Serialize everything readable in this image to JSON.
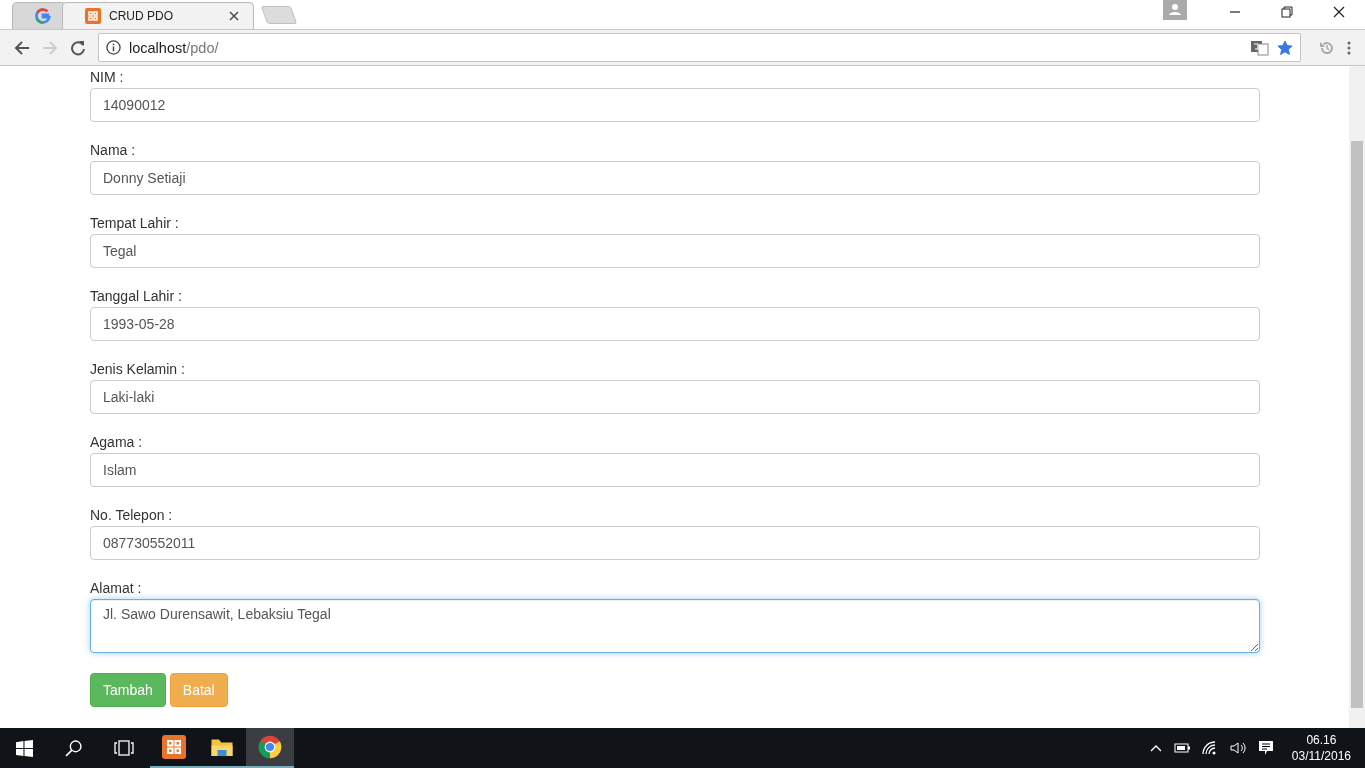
{
  "browser": {
    "tabs": [
      {
        "kind": "google",
        "selected": false
      },
      {
        "kind": "xampp",
        "title": "CRUD PDO",
        "selected": true
      }
    ],
    "url_host": "localhost",
    "url_path": "/pdo/",
    "bookmarked": true
  },
  "form": {
    "fields": [
      {
        "label": "NIM :",
        "value": "14090012",
        "kind": "input",
        "focused": false
      },
      {
        "label": "Nama :",
        "value": "Donny Setiaji",
        "kind": "input",
        "focused": false
      },
      {
        "label": "Tempat Lahir :",
        "value": "Tegal",
        "kind": "input",
        "focused": false
      },
      {
        "label": "Tanggal Lahir :",
        "value": "1993-05-28",
        "kind": "input",
        "focused": false
      },
      {
        "label": "Jenis Kelamin :",
        "value": "Laki-laki",
        "kind": "input",
        "focused": false
      },
      {
        "label": "Agama :",
        "value": "Islam",
        "kind": "input",
        "focused": false
      },
      {
        "label": "No. Telepon :",
        "value": "087730552011",
        "kind": "input",
        "focused": false
      },
      {
        "label": "Alamat :",
        "value": "Jl. Sawo Durensawit, Lebaksiu Tegal",
        "kind": "textarea",
        "focused": true
      }
    ],
    "buttons": [
      {
        "label": "Tambah",
        "kind": "success"
      },
      {
        "label": "Batal",
        "kind": "warning"
      }
    ]
  },
  "taskbar": {
    "apps": [
      {
        "kind": "xampp",
        "active": false
      },
      {
        "kind": "folder",
        "active": false
      },
      {
        "kind": "chrome",
        "active": true
      }
    ],
    "time": "06.16",
    "date": "03/11/2016"
  }
}
